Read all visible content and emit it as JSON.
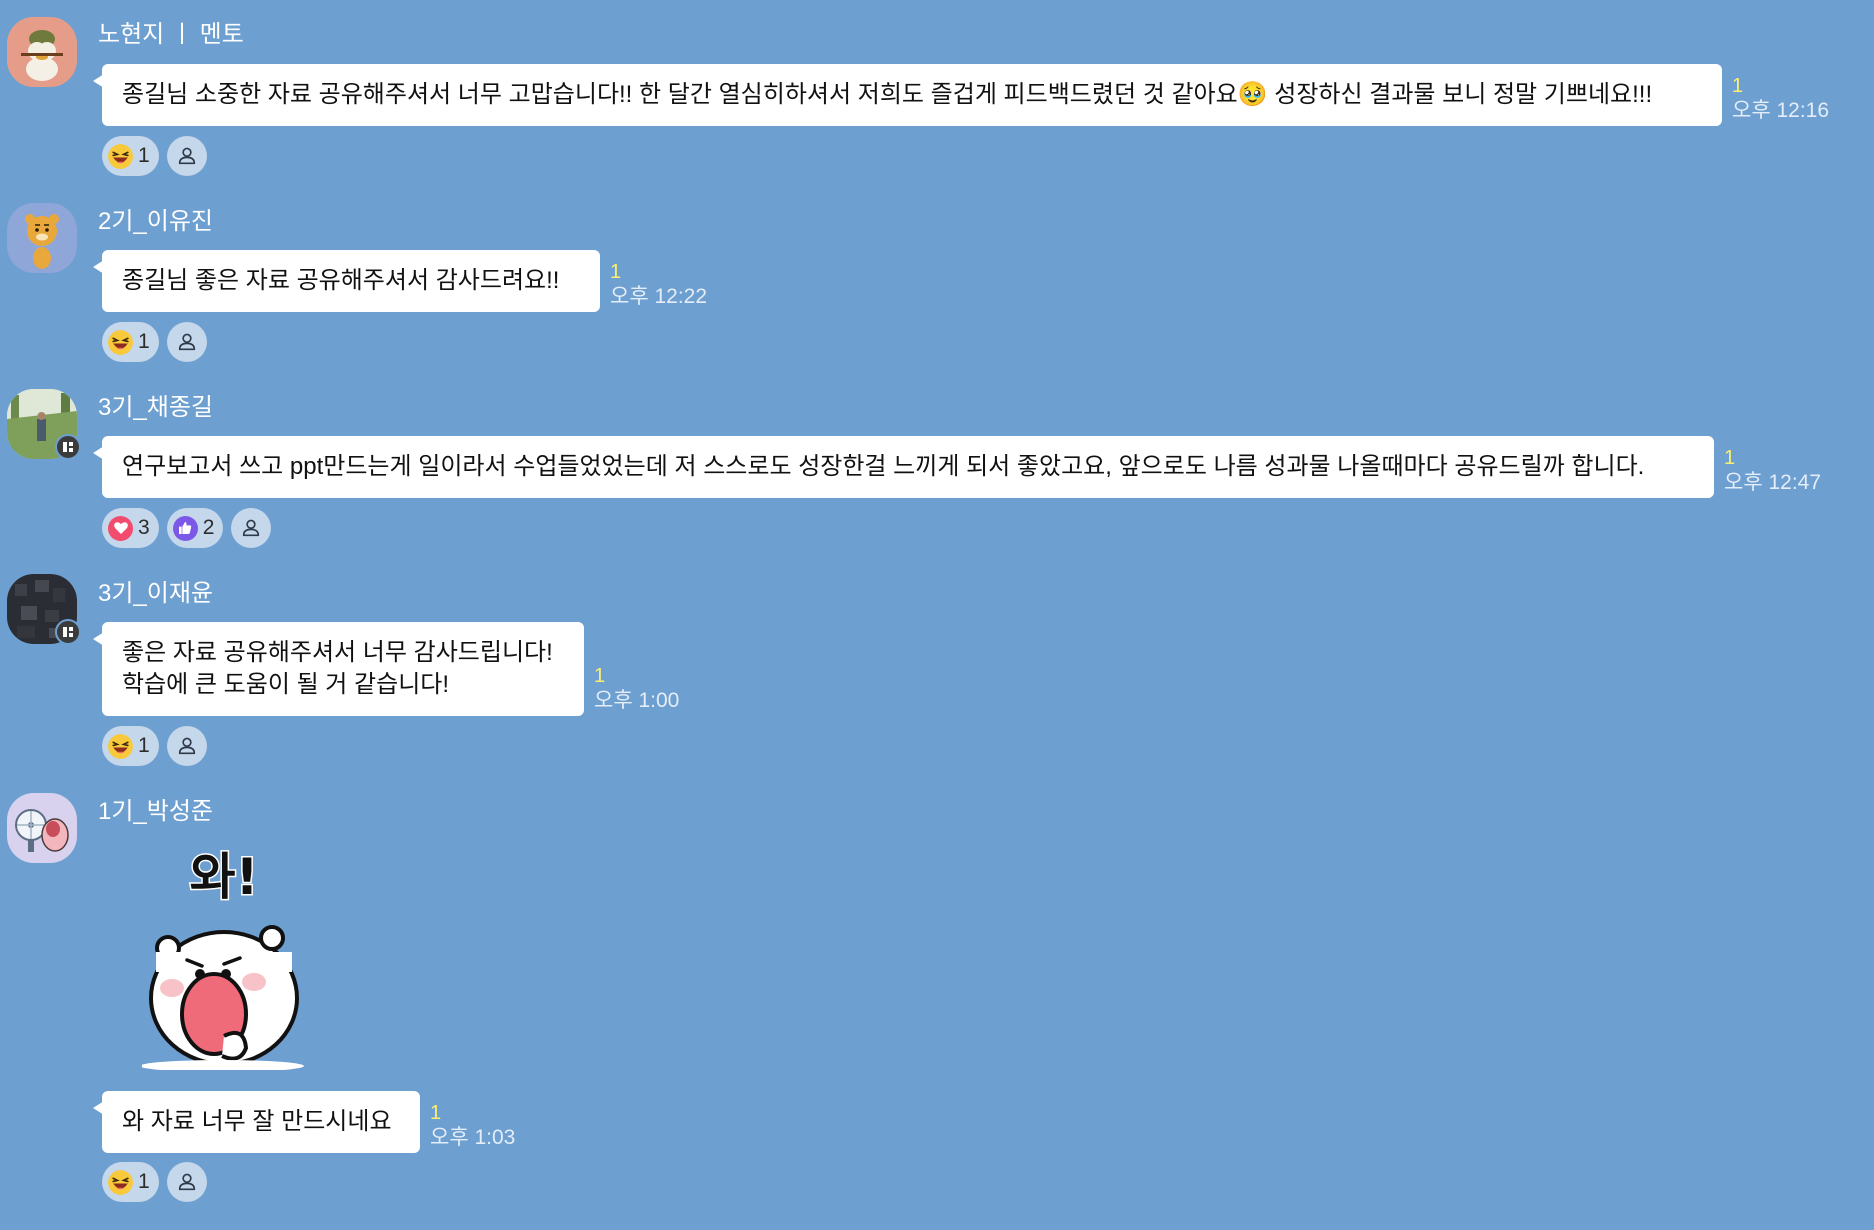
{
  "messages": [
    {
      "sender": "노현지 ㅣ 멘토",
      "lines": [
        "종길님 소중한 자료 공유해주셔서 너무 고맙습니다!! 한 달간 열심히하셔서 저희도 즐겁게 피드백드렸던 것 같아요🥹 성장하신 결과물 보니 정말 기쁘네요!!!"
      ],
      "unread": "1",
      "time": "오후 12:16",
      "reactions": [
        {
          "emoji": "laugh",
          "count": "1"
        }
      ]
    },
    {
      "sender": "2기_이유진",
      "lines": [
        "종길님 좋은 자료 공유해주셔서 감사드려요!!"
      ],
      "unread": "1",
      "time": "오후 12:22",
      "reactions": [
        {
          "emoji": "laugh",
          "count": "1"
        }
      ]
    },
    {
      "sender": "3기_채종길",
      "lines": [
        "연구보고서 쓰고 ppt만드는게 일이라서 수업들었었는데 저 스스로도 성장한걸 느끼게 되서 좋았고요, 앞으로도 나름 성과물 나올때마다 공유드릴까 합니다."
      ],
      "unread": "1",
      "time": "오후 12:47",
      "reactions": [
        {
          "emoji": "heart",
          "count": "3"
        },
        {
          "emoji": "thumbs-up",
          "count": "2"
        }
      ]
    },
    {
      "sender": "3기_이재윤",
      "lines": [
        "좋은 자료 공유해주셔서 너무 감사드립니다!",
        "학습에 큰 도움이 될 거 같습니다!"
      ],
      "unread": "1",
      "time": "오후 1:00",
      "reactions": [
        {
          "emoji": "laugh",
          "count": "1"
        }
      ]
    },
    {
      "sender": "1기_박성준",
      "sticker_text": "와!",
      "lines": [
        "와 자료 너무 잘 만드시네요"
      ],
      "unread": "1",
      "time": "오후 1:03",
      "reactions": [
        {
          "emoji": "laugh",
          "count": "1"
        }
      ]
    }
  ],
  "colors": {
    "background": "#6d9fd0",
    "bubble": "#ffffff",
    "unread": "#fdf16a",
    "reaction_pill": "#c5d7ea"
  }
}
